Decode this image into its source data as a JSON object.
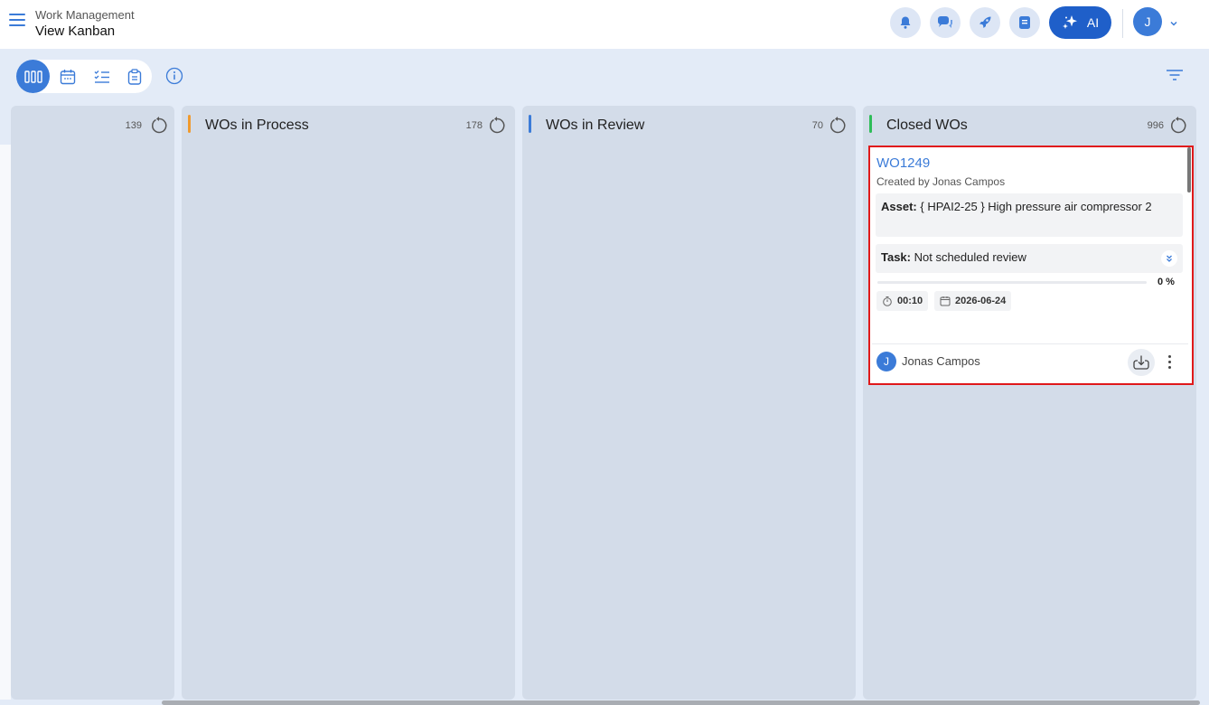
{
  "header": {
    "section": "Work Management",
    "page_title": "View Kanban",
    "ai_label": "AI",
    "user_initial": "J",
    "icons": [
      "bell-icon",
      "chat-icon",
      "rocket-icon",
      "document-icon",
      "sparkle-icon"
    ]
  },
  "toolbar": {
    "views": [
      "kanban-view-icon",
      "calendar-view-icon",
      "checklist-view-icon",
      "clipboard-view-icon"
    ],
    "active_view": "kanban-view-icon"
  },
  "columns": [
    {
      "title": "",
      "count": "139",
      "accent": ""
    },
    {
      "title": "WOs in Process",
      "count": "178",
      "accent": "#f09a2e"
    },
    {
      "title": "WOs in Review",
      "count": "70",
      "accent": "#3b7bd8"
    },
    {
      "title": "Closed WOs",
      "count": "996",
      "accent": "#2ebd59"
    }
  ],
  "card": {
    "id": "WO1249",
    "created_by": "Created by Jonas Campos",
    "asset_label": "Asset:",
    "asset_value": " { HPAI2-25 } High pressure air compressor 2",
    "task_label": "Task:",
    "task_value": " Not scheduled review",
    "progress_percent": 0,
    "progress_text": "0 %",
    "duration": "00:10",
    "date": "2026-06-24",
    "owner_initial": "J",
    "owner_name": "Jonas Campos"
  },
  "colors": {
    "primary": "#3b7bd8",
    "ai_button": "#1f5fc9",
    "highlight_border": "#e0191b"
  }
}
